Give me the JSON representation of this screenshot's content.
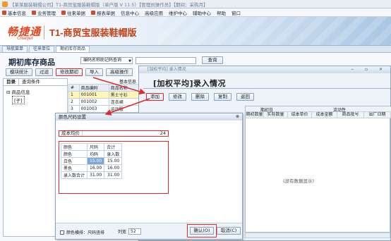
{
  "window": {
    "title": "【某某服装鞋帽公司】T1-商贸宝服装鞋帽版（单户版 V 11.5）【管理员操作员】【期间：采购月】"
  },
  "menubar": {
    "items": [
      "基本信息",
      "业务管理",
      "往来单据",
      "报表单据",
      "信息中心",
      "高级应用",
      "维护中心",
      "辅助中心",
      "帮助",
      "窗口"
    ]
  },
  "banner": {
    "brand": "畅捷通",
    "brand_sub": "Chanjet",
    "product": "T1-商贸宝服装鞋帽版"
  },
  "tabs": [
    "导航菜单",
    "往来单位",
    "期初库存商品"
  ],
  "page": {
    "title": "期初库存商品",
    "search_mode": "编码名称助记码查询",
    "search_value": "",
    "query_label": "查询"
  },
  "toolbar": {
    "buttons": [
      "模块统计",
      "过滤",
      "修改期初",
      "导入",
      "高级操作"
    ]
  },
  "left_panel": {
    "tabs": [
      "目录",
      "查询条件"
    ],
    "tree_root": "商品信息",
    "tree_child": "[子]"
  },
  "mini_grid": {
    "group_label": "基本信息",
    "headers": [
      "#",
      "商品编码",
      "商品名称"
    ],
    "rows": [
      [
        "1",
        "001001",
        "黑士寸衫"
      ],
      [
        "2",
        "001002",
        "连衣裙"
      ],
      [
        "3",
        "001003",
        "运动服"
      ]
    ]
  },
  "weighted_dialog": {
    "window_title": "[加权平均] 录入情况",
    "heading": "[加权平均]录入情况",
    "buttons": [
      "添加",
      "修改",
      "删除",
      "复制",
      "返回"
    ],
    "group_left": "期初日",
    "group_right": "流动性",
    "columns": [
      "期初数量",
      "实际数量",
      "成本单价",
      "成本金额",
      "商品批号",
      "出厂日期"
    ],
    "empty_text": "(没有数据显示)"
  },
  "color_dialog": {
    "title": "颜色尺码设置",
    "cost_label": "成本均价",
    "cost_value": "24",
    "table": {
      "header_row1": [
        "颜色",
        "尺码",
        "合计"
      ],
      "header_row2": [
        "颜色",
        "均码",
        "录入数"
      ],
      "rows": [
        [
          "白色",
          "",
          "15.00"
        ],
        [
          "黑色",
          "16.00",
          "16.00"
        ],
        [
          "录入数合计",
          "31.00",
          "31.00"
        ]
      ],
      "white_cell_value": "15.00"
    },
    "checkbox_label": "颜色横排：尺码竖排",
    "col_width_label": "列宽",
    "col_width_value": "52",
    "ok_label": "确认(O)",
    "cancel_label": "取消(C)"
  },
  "colors": {
    "highlight_red": "#e02a2a",
    "brand_orange": "#e0491f"
  }
}
